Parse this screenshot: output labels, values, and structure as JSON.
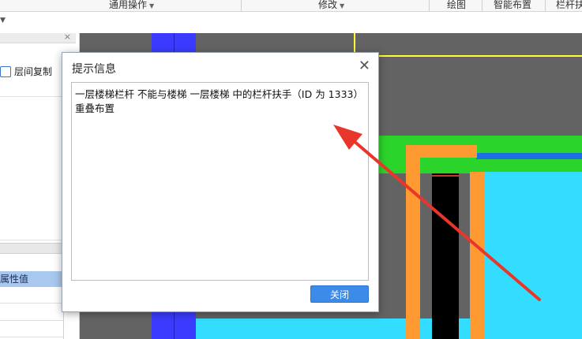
{
  "ribbon": {
    "items": [
      "通用操作",
      "修改",
      "绘图",
      "智能布置",
      "栏杆扶"
    ]
  },
  "left_panel": {
    "copy_label": "层间复制",
    "property_label": "属性值"
  },
  "dialog": {
    "title": "提示信息",
    "message": "一层楼梯栏杆 不能与楼梯 一层楼梯 中的栏杆扶手（ID 为 1333）重叠布置",
    "close_button": "关闭"
  },
  "colors": {
    "canvas_bg": "#636363",
    "blue_column": "#3b3bff",
    "green_beam": "#2bd42b",
    "orange_rail": "#ff9a33",
    "cyan_floor": "#33ddff",
    "arrow_red": "#e8362b",
    "button_blue": "#3d8be8"
  }
}
